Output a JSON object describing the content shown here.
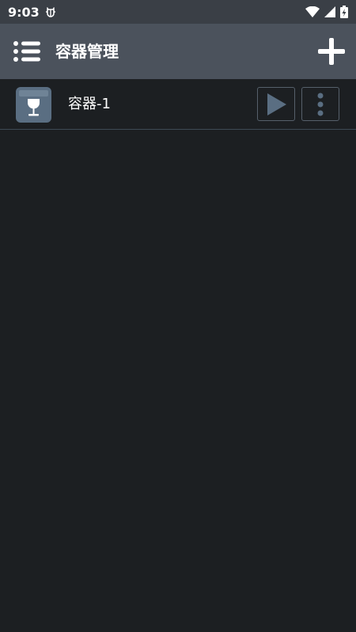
{
  "status_bar": {
    "time": "9:03",
    "icons": [
      "bug-icon",
      "wifi-icon",
      "signal-icon",
      "battery-charging-icon"
    ]
  },
  "app_bar": {
    "title": "容器管理",
    "menu_icon": "list-menu-icon",
    "add_icon": "plus-icon"
  },
  "containers": [
    {
      "name": "容器-1",
      "icon": "wine-glass-box-icon",
      "actions": [
        "play-icon",
        "more-vertical-icon"
      ]
    }
  ],
  "colors": {
    "background": "#1c1f22",
    "status_bar": "#3a3f46",
    "app_bar": "#4b525c",
    "icon_accent": "#5a6e82",
    "divider": "#3d4a55"
  }
}
